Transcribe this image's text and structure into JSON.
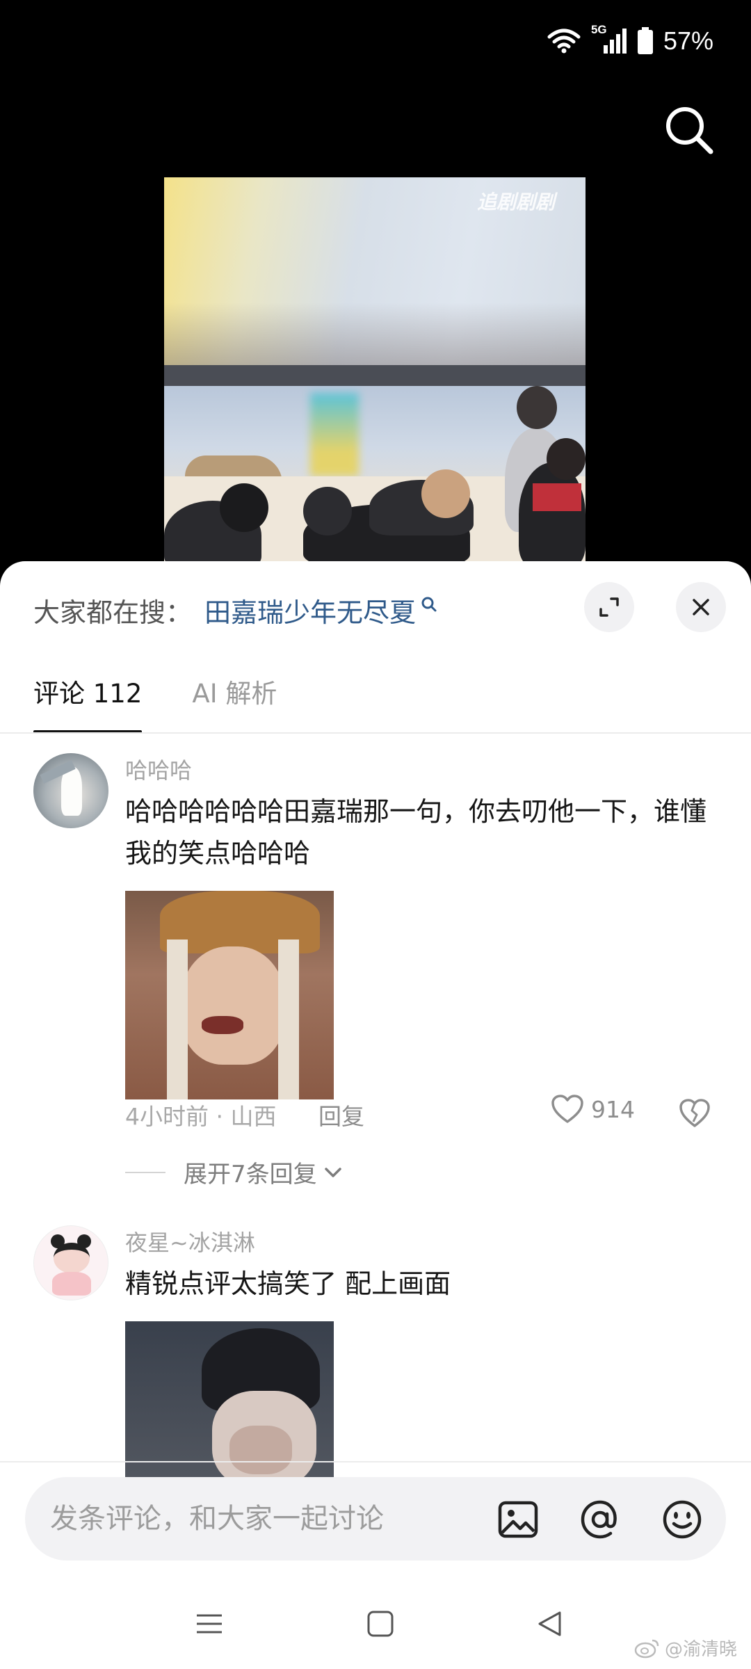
{
  "status_bar": {
    "network": "5G",
    "battery": "57%"
  },
  "video": {
    "watermark": "追剧剧剧"
  },
  "sheet": {
    "hot_search_label": "大家都在搜：",
    "hot_search_term": "田嘉瑞少年无尽夏",
    "tabs": [
      {
        "label": "评论 112",
        "active": true
      },
      {
        "label": "AI 解析",
        "active": false
      }
    ]
  },
  "comments": [
    {
      "username": "哈哈哈",
      "text": "哈哈哈哈哈哈田嘉瑞那一句，你去叨他一下，谁懂我的笑点哈哈哈",
      "time_location": "4小时前 · 山西",
      "reply_label": "回复",
      "likes": "914",
      "expand_replies": "展开7条回复"
    },
    {
      "username": "夜星~冰淇淋",
      "text": "精锐点评太搞笑了 配上画面"
    }
  ],
  "composer": {
    "placeholder": "发条评论，和大家一起讨论"
  },
  "watermark_bottom": "@渝清晓"
}
